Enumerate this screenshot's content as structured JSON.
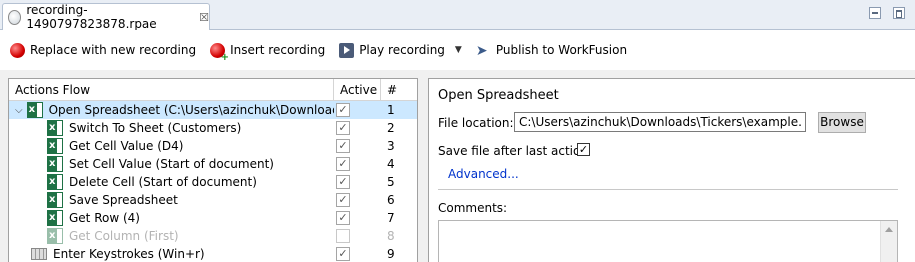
{
  "tab": {
    "title": "recording-1490797823878.rpae",
    "close_glyph": "☒"
  },
  "toolbar": {
    "replace_label": "Replace with new recording",
    "insert_label": "Insert recording",
    "play_label": "Play recording",
    "dropdown_glyph": "▼",
    "publish_label": "Publish to WorkFusion"
  },
  "actions_flow": {
    "columns": {
      "name": "Actions Flow",
      "active": "Active",
      "number": "#"
    },
    "rows": [
      {
        "name": "Open Spreadsheet (C:\\Users\\azinchuk\\Downloads\\Tickers\\example.xlsx)",
        "active": true,
        "num": "1",
        "icon": "excel-icon",
        "level": 0,
        "expanded": true,
        "selected": true
      },
      {
        "name": "Switch To Sheet (Customers)",
        "active": true,
        "num": "2",
        "icon": "excel-icon",
        "level": 1
      },
      {
        "name": "Get Cell Value (D4)",
        "active": true,
        "num": "3",
        "icon": "excel-icon",
        "level": 1
      },
      {
        "name": "Set Cell Value (Start of document)",
        "active": true,
        "num": "4",
        "icon": "excel-icon",
        "level": 1
      },
      {
        "name": "Delete Cell (Start of document)",
        "active": true,
        "num": "5",
        "icon": "excel-icon",
        "level": 1
      },
      {
        "name": "Save Spreadsheet",
        "active": true,
        "num": "6",
        "icon": "excel-icon",
        "level": 1
      },
      {
        "name": "Get Row (4)",
        "active": true,
        "num": "7",
        "icon": "excel-icon",
        "level": 1
      },
      {
        "name": "Get Column (First)",
        "active": false,
        "num": "8",
        "icon": "excel-icon",
        "level": 1,
        "disabled": true
      },
      {
        "name": "Enter Keystrokes (Win+r)",
        "active": true,
        "num": "9",
        "icon": "keyboard-icon",
        "level": 0
      }
    ]
  },
  "detail": {
    "title": "Open Spreadsheet",
    "file_location_label": "File location:",
    "file_location_value": "C:\\Users\\azinchuk\\Downloads\\Tickers\\example.xlsx",
    "browse_label": "Browse",
    "save_after_label": "Save file after last action",
    "save_after_checked": true,
    "advanced_label": "Advanced...",
    "comments_label": "Comments:"
  },
  "colors": {
    "selection": "#cce8ff",
    "link": "#0033cc",
    "excel": "#1e7145"
  }
}
